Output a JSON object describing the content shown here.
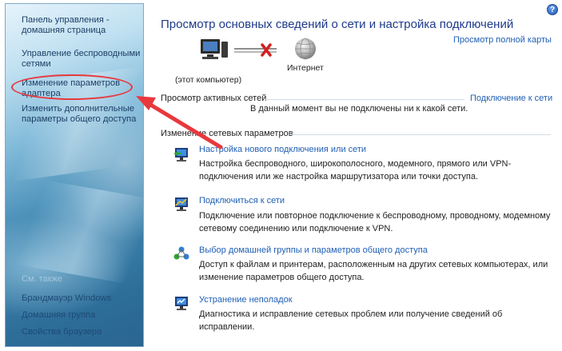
{
  "sidebar": {
    "items": [
      {
        "label": "Панель управления - домашняя страница"
      },
      {
        "label": "Управление беспроводными сетями"
      },
      {
        "label": "Изменение параметров адаптера"
      },
      {
        "label": "Изменить дополнительные параметры общего доступа"
      }
    ],
    "see_also": "См. также",
    "see_also_items": [
      {
        "label": "Брандмауэр Windows"
      },
      {
        "label": "Домашняя группа"
      },
      {
        "label": "Свойства браузера"
      }
    ]
  },
  "header": {
    "title": "Просмотр основных сведений о сети и настройка подключений",
    "full_map_link": "Просмотр полной карты",
    "help": "?"
  },
  "network_map": {
    "computer_label": "(этот компьютер)",
    "internet_label": "Интернет",
    "status_icon": "red-x-icon"
  },
  "active_networks": {
    "heading": "Просмотр активных сетей",
    "connect_link": "Подключение к сети",
    "status": "В данный момент вы не подключены ни к какой сети."
  },
  "change_settings": {
    "heading": "Изменение сетевых параметров",
    "tasks": [
      {
        "title": "Настройка нового подключения или сети",
        "desc": "Настройка беспроводного, широкополосного, модемного, прямого или VPN-подключения или же настройка маршрутизатора или точки доступа.",
        "icon": "new-connection-icon"
      },
      {
        "title": "Подключиться к сети",
        "desc": "Подключение или повторное подключение к беспроводному, проводному, модемному сетевому соединению или подключение к VPN.",
        "icon": "connect-network-icon"
      },
      {
        "title": "Выбор домашней группы и параметров общего доступа",
        "desc": "Доступ к файлам и принтерам, расположенным на других сетевых компьютерах, или изменение параметров общего доступа.",
        "icon": "homegroup-icon"
      },
      {
        "title": "Устранение неполадок",
        "desc": "Диагностика и исправление сетевых проблем или получение сведений об исправлении.",
        "icon": "troubleshoot-icon"
      }
    ]
  },
  "colors": {
    "link": "#1f5fb5",
    "title": "#1e3a8a",
    "highlight": "#e8383d"
  }
}
